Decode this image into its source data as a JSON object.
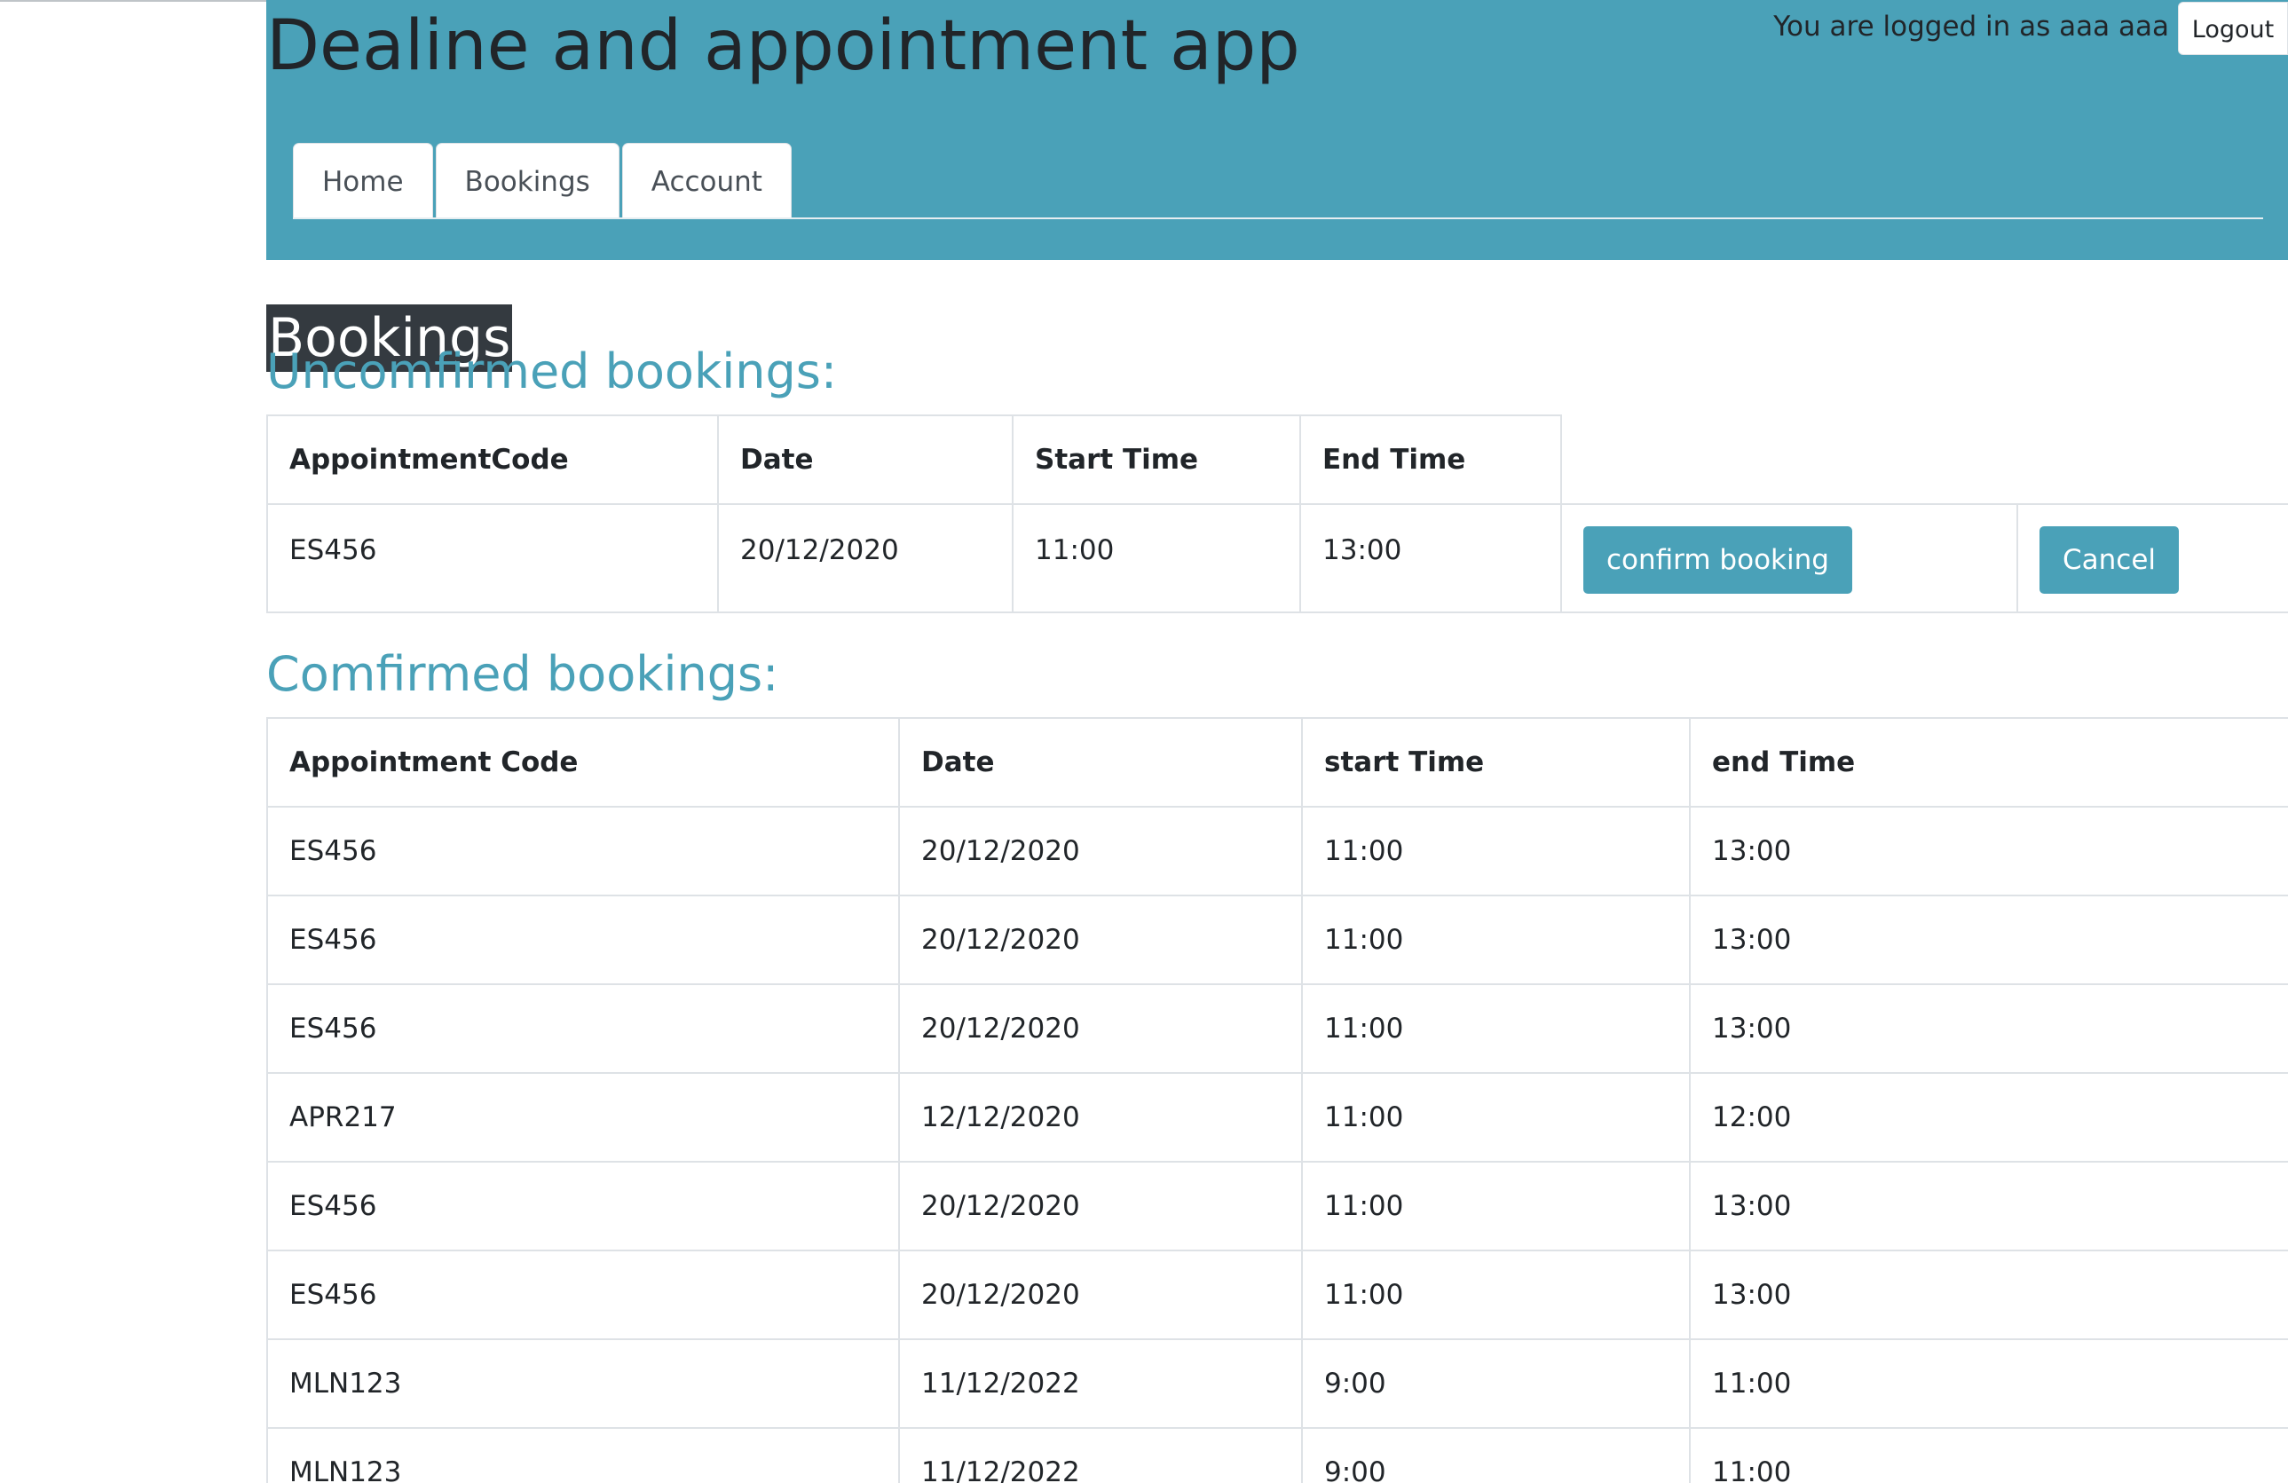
{
  "header": {
    "app_title": "Dealine and appointment app",
    "login_status": "You are logged in as aaa aaa",
    "logout_label": "Logout",
    "accent_color": "#4aa1b8",
    "tabs": [
      {
        "label": "Home"
      },
      {
        "label": "Bookings"
      },
      {
        "label": "Account"
      }
    ]
  },
  "page": {
    "heading": "Bookings"
  },
  "unconfirmed": {
    "title": "Uncomfirmed bookings:",
    "columns": [
      "AppointmentCode",
      "Date",
      "Start Time",
      "End Time"
    ],
    "rows": [
      {
        "code": "ES456",
        "date": "20/12/2020",
        "start": "11:00",
        "end": "13:00"
      }
    ],
    "confirm_label": "confirm booking",
    "cancel_label": "Cancel"
  },
  "confirmed": {
    "title": "Comfirmed bookings:",
    "columns": [
      "Appointment Code",
      "Date",
      "start Time",
      "end Time"
    ],
    "rows": [
      {
        "code": "ES456",
        "date": "20/12/2020",
        "start": "11:00",
        "end": "13:00"
      },
      {
        "code": "ES456",
        "date": "20/12/2020",
        "start": "11:00",
        "end": "13:00"
      },
      {
        "code": "ES456",
        "date": "20/12/2020",
        "start": "11:00",
        "end": "13:00"
      },
      {
        "code": "APR217",
        "date": "12/12/2020",
        "start": "11:00",
        "end": "12:00"
      },
      {
        "code": "ES456",
        "date": "20/12/2020",
        "start": "11:00",
        "end": "13:00"
      },
      {
        "code": "ES456",
        "date": "20/12/2020",
        "start": "11:00",
        "end": "13:00"
      },
      {
        "code": "MLN123",
        "date": "11/12/2022",
        "start": "9:00",
        "end": "11:00"
      },
      {
        "code": "MLN123",
        "date": "11/12/2022",
        "start": "9:00",
        "end": "11:00"
      }
    ]
  }
}
